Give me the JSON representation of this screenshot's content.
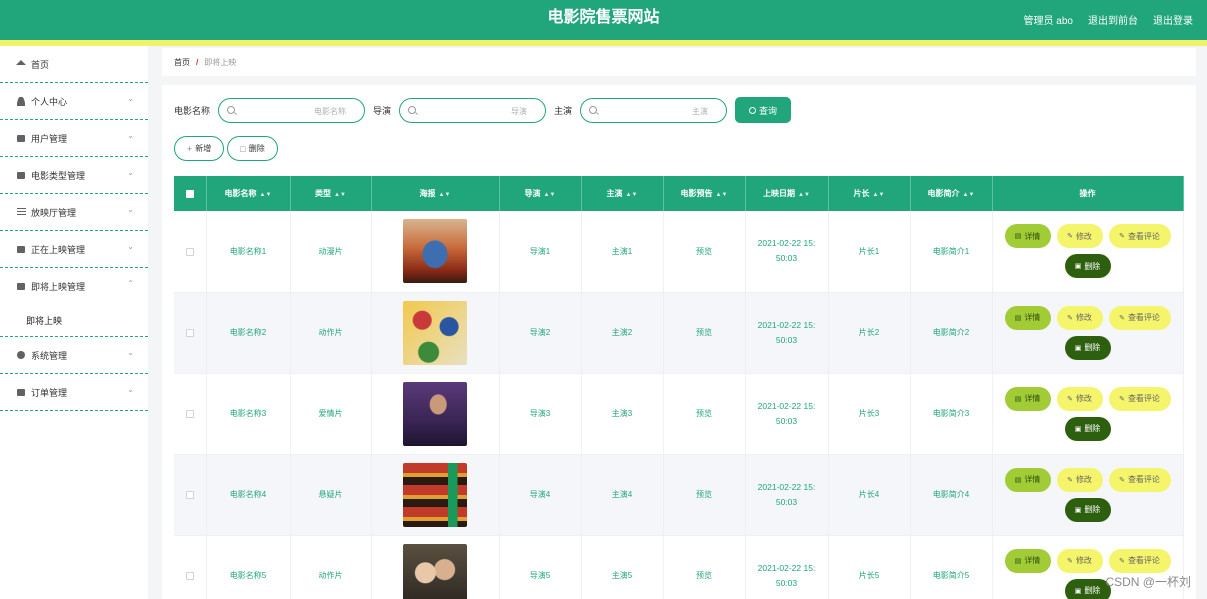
{
  "header": {
    "title": "电影院售票网站",
    "admin_label": "管理员 abo",
    "goto_front_label": "退出到前台",
    "logout_label": "退出登录"
  },
  "sidebar": {
    "items": [
      {
        "label": "首页",
        "icon": "home-icon"
      },
      {
        "label": "个人中心",
        "icon": "person-icon"
      },
      {
        "label": "用户管理",
        "icon": "chat-icon"
      },
      {
        "label": "电影类型管理",
        "icon": "monitor-icon"
      },
      {
        "label": "放映厅管理",
        "icon": "sliders-icon"
      },
      {
        "label": "正在上映管理",
        "icon": "tv-icon"
      },
      {
        "label": "即将上映管理",
        "icon": "clipboard-icon"
      },
      {
        "label": "系统管理",
        "icon": "globe-icon"
      },
      {
        "label": "订单管理",
        "icon": "clipboard-icon"
      }
    ],
    "sub_item": "即将上映"
  },
  "breadcrumb": {
    "home": "首页",
    "separator": "/",
    "current": "即将上映"
  },
  "search": {
    "name_label": "电影名称",
    "name_placeholder": "电影名称",
    "director_label": "导演",
    "director_placeholder": "导演",
    "actor_label": "主演",
    "actor_placeholder": "主演",
    "query_label": "查询"
  },
  "actions": {
    "add_label": "新增",
    "delete_label": "删除"
  },
  "table": {
    "columns": [
      "电影名称",
      "类型",
      "海报",
      "导演",
      "主演",
      "电影预告",
      "上映日期",
      "片长",
      "电影简介",
      "操作"
    ],
    "rows": [
      {
        "name": "电影名称1",
        "type": "动漫片",
        "director": "导演1",
        "actor": "主演1",
        "trailer": "预览",
        "date_a": "2021-02-22 15:",
        "date_b": "50:03",
        "length": "片长1",
        "intro": "电影简介1"
      },
      {
        "name": "电影名称2",
        "type": "动作片",
        "director": "导演2",
        "actor": "主演2",
        "trailer": "预览",
        "date_a": "2021-02-22 15:",
        "date_b": "50:03",
        "length": "片长2",
        "intro": "电影简介2"
      },
      {
        "name": "电影名称3",
        "type": "爱情片",
        "director": "导演3",
        "actor": "主演3",
        "trailer": "预览",
        "date_a": "2021-02-22 15:",
        "date_b": "50:03",
        "length": "片长3",
        "intro": "电影简介3"
      },
      {
        "name": "电影名称4",
        "type": "悬疑片",
        "director": "导演4",
        "actor": "主演4",
        "trailer": "预览",
        "date_a": "2021-02-22 15:",
        "date_b": "50:03",
        "length": "片长4",
        "intro": "电影简介4"
      },
      {
        "name": "电影名称5",
        "type": "动作片",
        "director": "导演5",
        "actor": "主演5",
        "trailer": "预览",
        "date_a": "2021-02-22 15:",
        "date_b": "50:03",
        "length": "片长5",
        "intro": "电影简介5"
      }
    ],
    "ops": {
      "detail": "详情",
      "edit": "修改",
      "review": "查看评论",
      "delete": "删除"
    }
  },
  "watermark": "CSDN @一杯刘",
  "colors": {
    "primary": "#20a67a",
    "accent_stripe": "#f0f36a",
    "detail_button": "#a2cc36",
    "edit_button": "#f4f56a",
    "delete_button": "#2d5f0f"
  }
}
